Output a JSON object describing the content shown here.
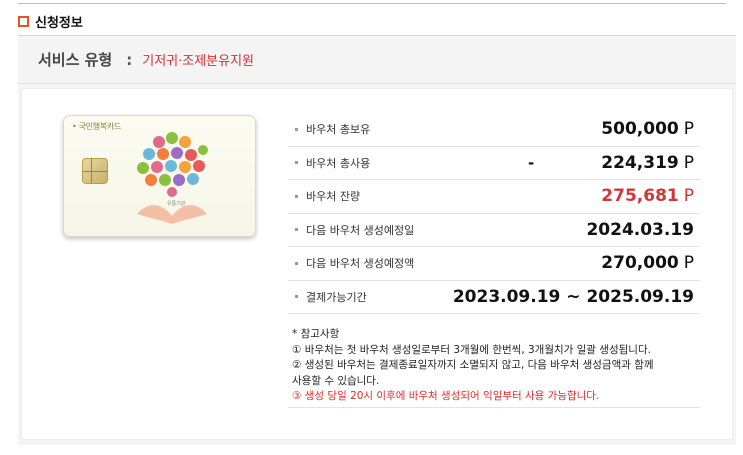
{
  "section": {
    "title": "신청정보"
  },
  "service": {
    "label": "서비스 유형",
    "colon": ":",
    "value": "기저귀·조제분유지원"
  },
  "card": {
    "logo_text": "• 국민행복카드",
    "issuer_text": "유통기관"
  },
  "voucher_items": [
    {
      "label": "바우처 총보유",
      "value": "500,000",
      "unit": "P"
    },
    {
      "label": "바우처 총사용",
      "prefix": "-",
      "value": "224,319",
      "unit": "P"
    },
    {
      "label": "바우처 잔량",
      "value": "275,681",
      "unit": "P"
    },
    {
      "label": "다음 바우처 생성예정일",
      "value": "2024.03.19"
    },
    {
      "label": "다음 바우처 생성예정액",
      "value": "270,000",
      "unit": "P"
    },
    {
      "label": "결제가능기간",
      "value": "2023.09.19 ~ 2025.09.19"
    }
  ],
  "notes": {
    "title": "* 참고사항",
    "line1": "① 바우처는 첫 바우처 생성일로부터 3개월에 한번씩, 3개월치가 일괄 생성됩니다.",
    "line2a": "② 생성된 바우처는 결제종료일자까지 소멸되지 않고, 다음 바우처 생성금액과 함께",
    "line2b": "사용할 수 있습니다.",
    "line3": "③ 생성 당일 20시 이후에 바우처 생성되어 익일부터 사용 가능합니다."
  },
  "colors": {
    "accent": "#e8541c",
    "highlight_red": "#d23737"
  }
}
